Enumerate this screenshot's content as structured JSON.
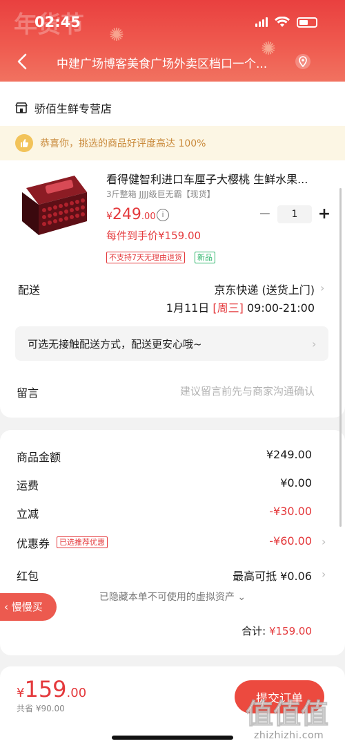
{
  "status": {
    "time": "02:45"
  },
  "header": {
    "address": "中建广场博客美食广场外卖区档口一个..."
  },
  "shop": {
    "name": "骄佰生鲜专营店"
  },
  "banner": {
    "text": "恭喜你，挑选的商品好评度高达 100%"
  },
  "product": {
    "title": "看得健智利进口车厘子大樱桃 生鲜水果...",
    "spec": "3斤整箱 JJJJ级巨无霸【现货】",
    "price_currency": "¥",
    "price_int": "249",
    "price_dec": ".00",
    "info": "i",
    "quantity": "1",
    "minus": "−",
    "plus": "+",
    "unit_price": "每件到手价¥159.00",
    "tags": [
      "不支持7天无理由退货",
      "新品"
    ]
  },
  "delivery": {
    "label": "配送",
    "method": "京东快递 (送货上门)",
    "date": "1月11日",
    "weekday": "[周三]",
    "time": "09:00-21:00",
    "contactless": "可选无接触配送方式，配送更安心哦~"
  },
  "note": {
    "label": "留言",
    "placeholder": "建议留言前先与商家沟通确认"
  },
  "summary": {
    "rows": [
      {
        "label": "商品金额",
        "value": "¥249.00"
      },
      {
        "label": "运费",
        "value": "¥0.00"
      },
      {
        "label": "立减",
        "value": "-¥30.00"
      },
      {
        "label": "优惠券",
        "value": "-¥60.00"
      },
      {
        "label": "红包",
        "value": "最高可抵 ¥0.06"
      }
    ],
    "coupon_tag": "已选推荐优惠",
    "hidden_assets": "已隐藏本单不可使用的虚拟资产 ⌄",
    "total_label": "合计: ",
    "total_value": "¥159.00"
  },
  "slow_buy": "‹ 慢慢买",
  "footer": {
    "currency": "¥",
    "price_int": "159",
    "price_dec": ".00",
    "saved": "共省 ¥90.00",
    "submit": "提交订单"
  },
  "watermark": {
    "site": "zhizhizhi.com",
    "logo": "值值值"
  },
  "colors": {
    "accent": "#e4393c",
    "header": "#ef5a4f",
    "green": "#2db56b",
    "gold": "#c9893a"
  }
}
